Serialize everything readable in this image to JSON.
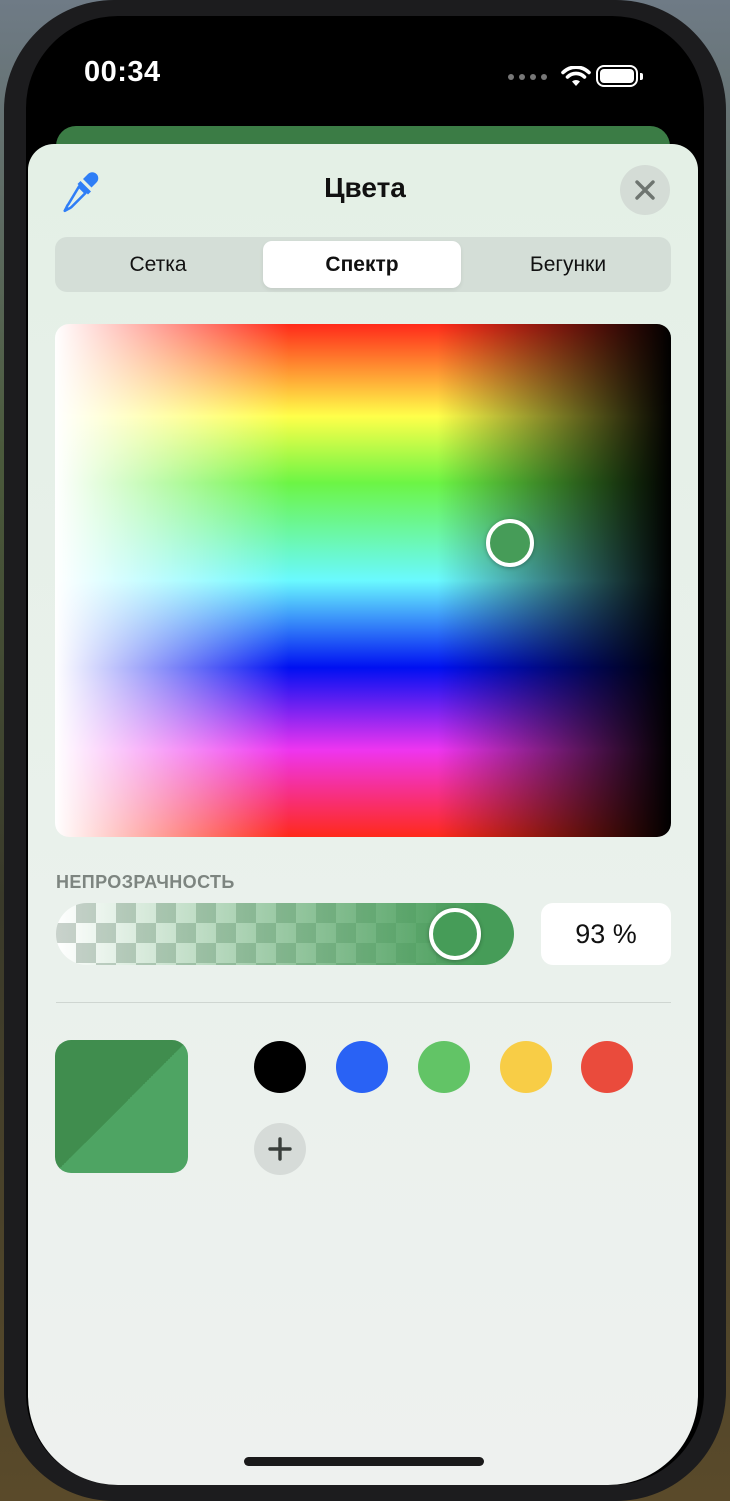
{
  "status_bar": {
    "time": "00:34"
  },
  "sheet": {
    "title": "Цвета",
    "tabs": [
      {
        "label": "Сетка",
        "active": false
      },
      {
        "label": "Спектр",
        "active": true
      },
      {
        "label": "Бегунки",
        "active": false
      }
    ],
    "opacity": {
      "label": "НЕПРОЗРАЧНОСТЬ",
      "value_text": "93 %",
      "value": 93
    },
    "current_color": "#469c58",
    "saved_swatches": [
      {
        "name": "black",
        "color": "#000000"
      },
      {
        "name": "blue",
        "color": "#2962f5"
      },
      {
        "name": "green",
        "color": "#62c466"
      },
      {
        "name": "yellow",
        "color": "#f8cd46"
      },
      {
        "name": "red",
        "color": "#ea4b3c"
      }
    ]
  },
  "icons": {
    "eyedropper": "eyedropper-icon",
    "close": "close-icon",
    "add": "plus-icon"
  },
  "colors": {
    "accent": "#2f7ef6",
    "selected_green": "#469c58"
  }
}
